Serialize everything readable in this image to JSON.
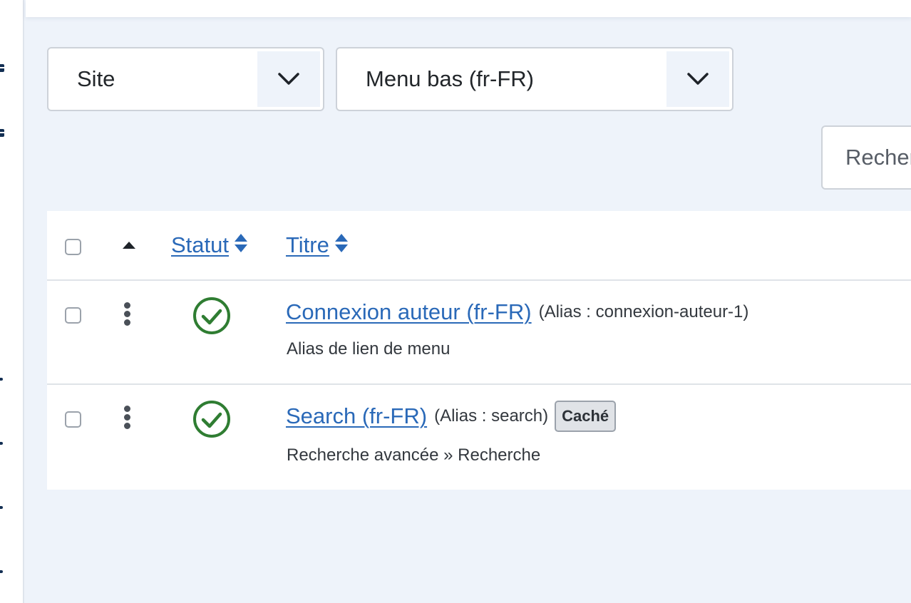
{
  "filters": {
    "client_select": {
      "value": "Site",
      "icon": "chevron-down-icon"
    },
    "menu_select": {
      "value": "Menu bas (fr-FR)",
      "icon": "chevron-down-icon"
    }
  },
  "search": {
    "placeholder": "Rechercher"
  },
  "table": {
    "headers": {
      "status": "Statut",
      "title": "Titre"
    },
    "rows": [
      {
        "title": "Connexion auteur (fr-FR)",
        "alias": "(Alias : connexion-auteur-1)",
        "badge": "",
        "subtext": "Alias de lien de menu",
        "status": "published"
      },
      {
        "title": "Search (fr-FR)",
        "alias": "(Alias : search)",
        "badge": "Caché",
        "subtext": "Recherche avancée » Recherche",
        "status": "published"
      }
    ]
  },
  "colors": {
    "link": "#2a69b8",
    "published": "#2f7d32",
    "sidebar_icon": "#132f53",
    "background": "#eef3fa"
  }
}
